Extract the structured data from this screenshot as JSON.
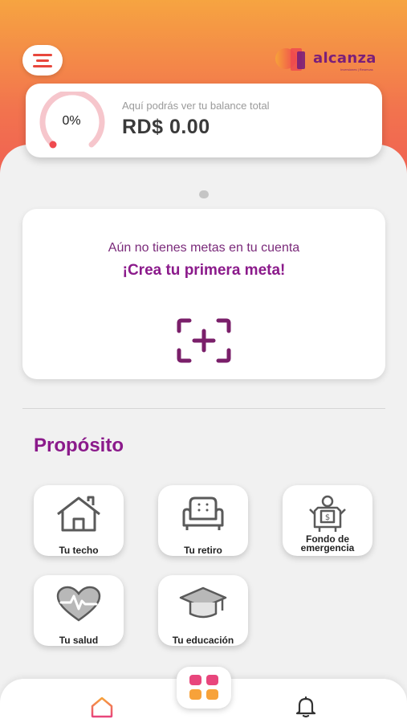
{
  "header": {
    "menu_icon": "hamburger-icon",
    "logo_text": "alcanza",
    "logo_subtitle": "Inversiones | Reservas"
  },
  "balance": {
    "percent": "0%",
    "percent_value": 0,
    "label": "Aquí podrás ver tu balance total",
    "value": "RD$ 0.00"
  },
  "goals": {
    "empty_text": "Aún no tienes metas en tu cuenta",
    "cta_text": "¡Crea tu primera meta!",
    "add_icon": "add-goal-icon"
  },
  "purpose": {
    "title": "Propósito",
    "items": [
      {
        "label": "Tu techo",
        "icon": "house-icon"
      },
      {
        "label": "Tu retiro",
        "icon": "armchair-icon"
      },
      {
        "label": "Fondo de emergencia",
        "label_line1": "Fondo de",
        "label_line2": "emergencia",
        "icon": "emergency-fund-icon"
      },
      {
        "label": "Tu salud",
        "icon": "heart-pulse-icon"
      },
      {
        "label": "Tu educación",
        "icon": "graduation-cap-icon"
      }
    ]
  },
  "bottom_nav": {
    "home_icon": "home-icon",
    "center_icon": "grid-icon",
    "bell_icon": "bell-icon"
  },
  "colors": {
    "brand_purple": "#8b1a8b",
    "header_orange": "#f6a441",
    "header_red": "#ef5a55",
    "grid_pink": "#e8467c",
    "grid_orange": "#f7a23a"
  }
}
